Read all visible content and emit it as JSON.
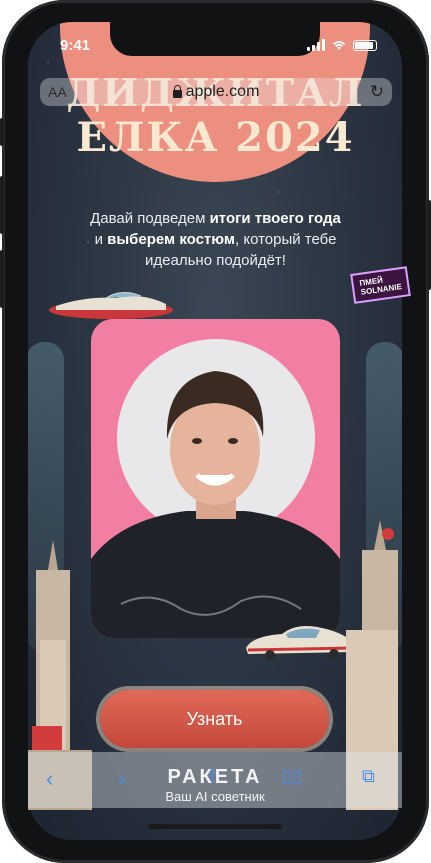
{
  "status_bar": {
    "time": "9:41"
  },
  "browser": {
    "text_size_label": "AA",
    "url": "apple.com",
    "reload_icon": "reload-icon",
    "lock_icon": "lock-icon"
  },
  "hero": {
    "title_line1": "ДИДЖИТАЛ",
    "title_line2": "ЕЛКА 2024",
    "subtitle_part1": "Давай подведем ",
    "subtitle_bold1": "итоги твоего года",
    "subtitle_part2": "и ",
    "subtitle_bold2": "выберем костюм",
    "subtitle_part3": ", который тебе идеально подойдёт!"
  },
  "card": {
    "sticker_text_line1": "ПМЕЙ",
    "sticker_text_line2": "SOLNANIE"
  },
  "cta": {
    "label": "Узнать"
  },
  "brand": {
    "name": "РАКЕТА",
    "tagline": "Ваш AI советник"
  },
  "toolbar": {
    "back_icon": "chevron-left-icon",
    "forward_icon": "chevron-right-icon",
    "share_icon": "share-icon",
    "bookmarks_icon": "book-icon",
    "tabs_icon": "tabs-icon"
  },
  "colors": {
    "background": "#2a3340",
    "sun": "#ec8f7e",
    "title": "#fbe8d0",
    "card": "#f27fa2",
    "cta": "#d65a49",
    "toolbar_icon": "#4a8dea"
  }
}
